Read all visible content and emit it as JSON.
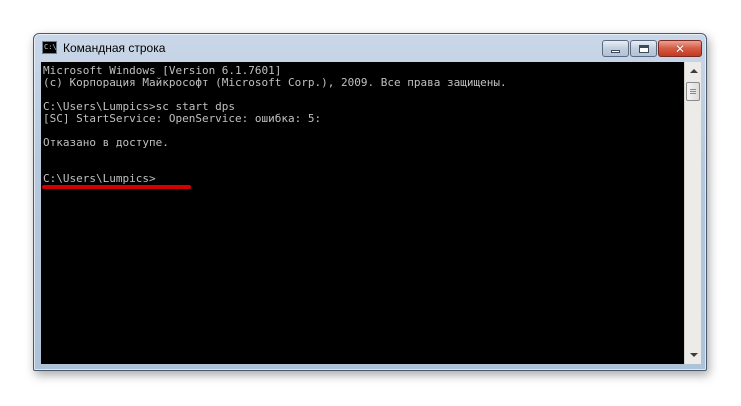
{
  "window": {
    "title": "Командная строка",
    "icon": "console-icon",
    "icon_text": "C:\\",
    "controls": {
      "minimize": "minimize-icon",
      "maximize": "maximize-icon",
      "close": "close-icon",
      "close_glyph": "✕"
    }
  },
  "console": {
    "lines": [
      "Microsoft Windows [Version 6.1.7601]",
      "(c) Корпорация Майкрософт (Microsoft Corp.), 2009. Все права защищены.",
      "",
      "C:\\Users\\Lumpics>sc start dps",
      "[SC] StartService: OpenService: ошибка: 5:",
      "",
      "Отказано в доступе.",
      "",
      "",
      "C:\\Users\\Lumpics>"
    ],
    "text_color": "#c0c0c0",
    "background": "#000000",
    "highlight_color": "#d40000"
  }
}
